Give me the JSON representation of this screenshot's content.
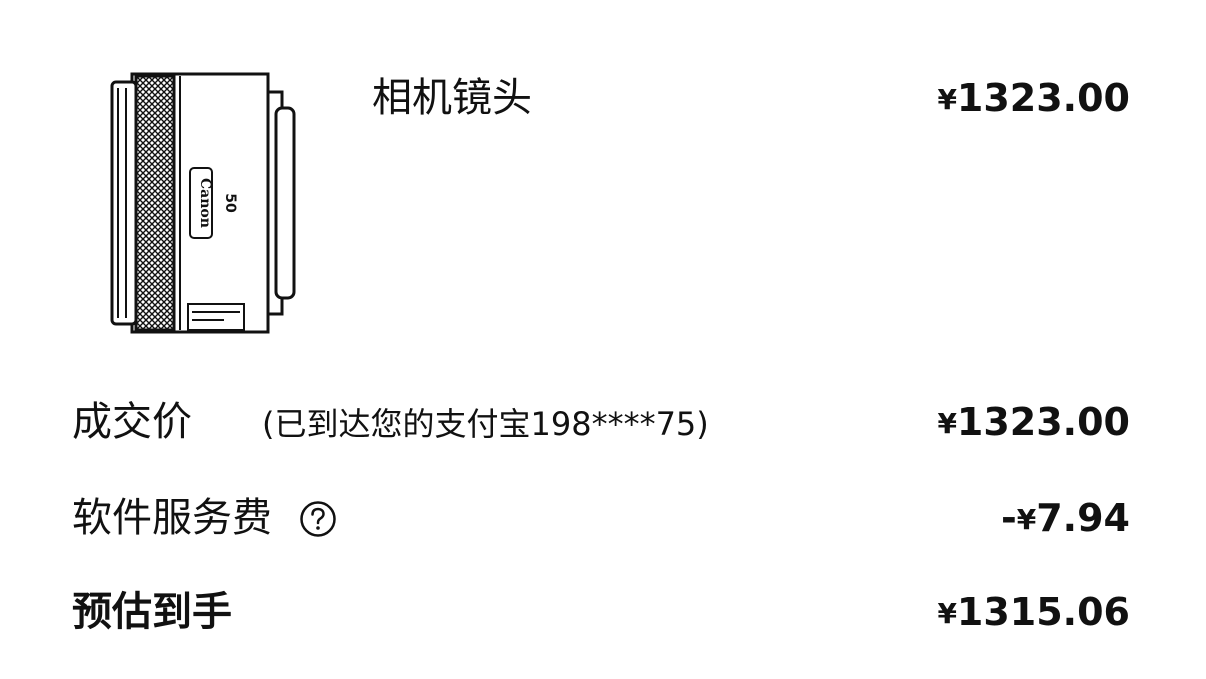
{
  "product": {
    "title": "相机镜头",
    "currency": "¥",
    "price": "1323.00",
    "image_icon": "canon-lens-image",
    "lens_brand": "Canon",
    "lens_focal": "50"
  },
  "rows": {
    "deal_price": {
      "label": "成交价",
      "note": "(已到达您的支付宝198****75)",
      "currency": "¥",
      "amount": "1323.00"
    },
    "service_fee": {
      "label": "软件服务费",
      "help_icon": "question-circle-icon",
      "sign": "-",
      "currency": "¥",
      "amount": "7.94"
    },
    "estimated": {
      "label": "预估到手",
      "currency": "¥",
      "amount": "1315.06"
    }
  }
}
